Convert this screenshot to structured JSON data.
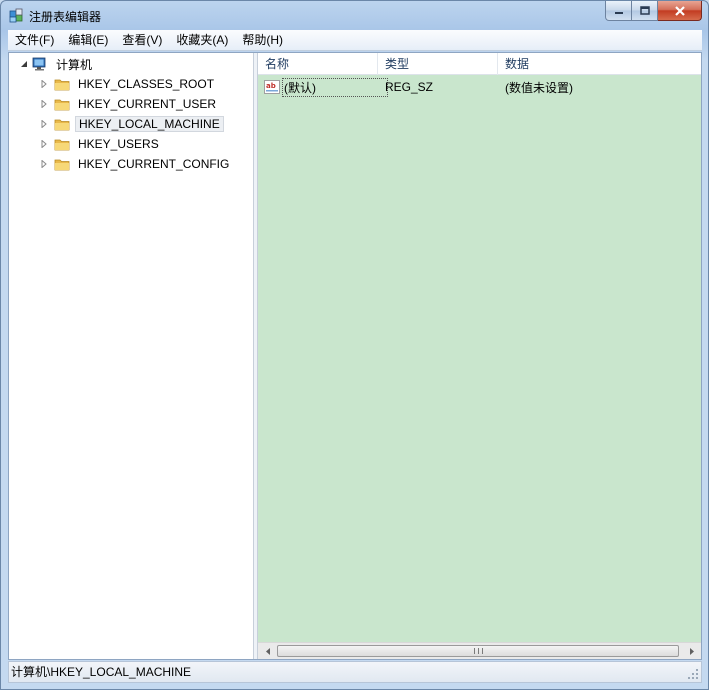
{
  "window": {
    "title": "注册表编辑器"
  },
  "menubar": {
    "items": [
      "文件(F)",
      "编辑(E)",
      "查看(V)",
      "收藏夹(A)",
      "帮助(H)"
    ]
  },
  "tree": {
    "root": {
      "label": "计算机",
      "expanded": true,
      "icon": "computer-icon"
    },
    "children": [
      {
        "label": "HKEY_CLASSES_ROOT",
        "selected": false
      },
      {
        "label": "HKEY_CURRENT_USER",
        "selected": false
      },
      {
        "label": "HKEY_LOCAL_MACHINE",
        "selected": true
      },
      {
        "label": "HKEY_USERS",
        "selected": false
      },
      {
        "label": "HKEY_CURRENT_CONFIG",
        "selected": false
      }
    ]
  },
  "list": {
    "columns": [
      "名称",
      "类型",
      "数据"
    ],
    "rows": [
      {
        "name": "(默认)",
        "type": "REG_SZ",
        "data": "(数值未设置)",
        "icon": "string-value-icon"
      }
    ]
  },
  "statusbar": {
    "path": "计算机\\HKEY_LOCAL_MACHINE"
  },
  "colors": {
    "list_background": "#c9e6cd",
    "folder": "#f3cf5b",
    "close_button": "#c33c22"
  }
}
